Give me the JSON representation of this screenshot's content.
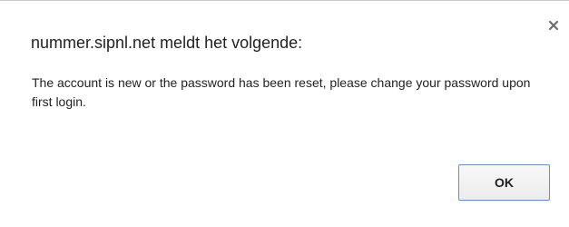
{
  "dialog": {
    "title": "nummer.sipnl.net meldt het volgende:",
    "message": "The account is new or the password has been reset, please change your password upon first login.",
    "ok_label": "OK",
    "close_icon": "close-icon"
  },
  "colors": {
    "button_border": "#4d90fe",
    "text": "#222222",
    "close_icon": "#6e6e6e"
  }
}
